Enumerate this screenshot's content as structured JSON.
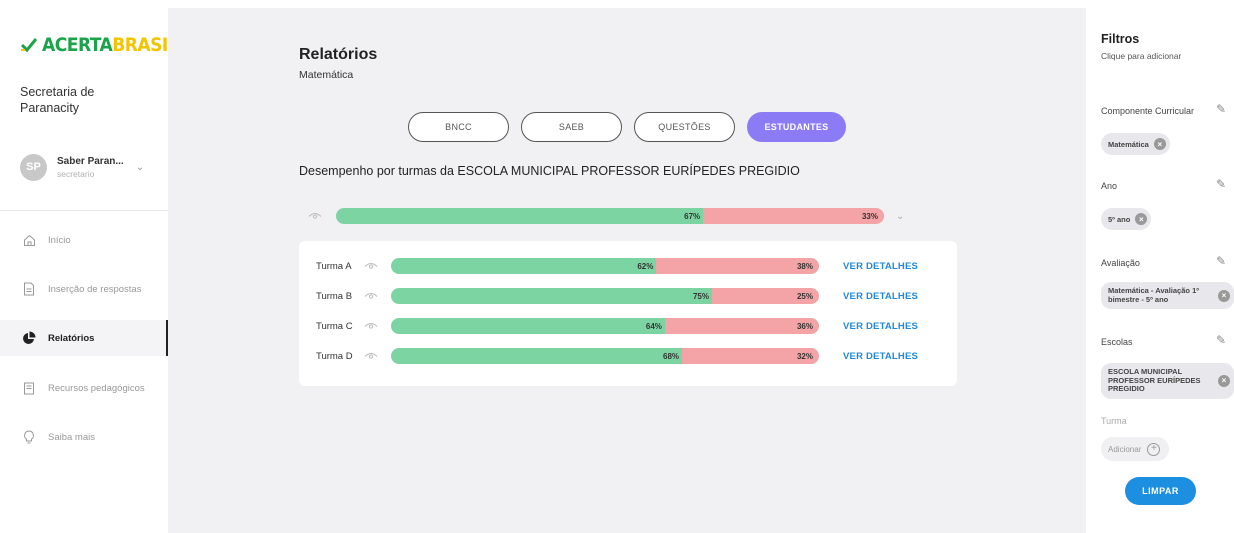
{
  "brand": {
    "part1": "ACERTA",
    "part2": "BRASIL"
  },
  "org": "Secretaria de Paranacity",
  "user": {
    "initials": "SP",
    "name": "Saber Paran...",
    "role": "secretario"
  },
  "nav": [
    {
      "label": "Início",
      "icon": "home-icon"
    },
    {
      "label": "Inserção de respostas",
      "icon": "document-icon"
    },
    {
      "label": "Relatórios",
      "icon": "pie-chart-icon"
    },
    {
      "label": "Recursos pedagógicos",
      "icon": "book-icon"
    },
    {
      "label": "Saiba mais",
      "icon": "lightbulb-icon"
    }
  ],
  "page": {
    "title": "Relatórios",
    "subtitle": "Matemática"
  },
  "tabs": [
    {
      "label": "BNCC",
      "active": false
    },
    {
      "label": "SAEB",
      "active": false
    },
    {
      "label": "QUESTÕES",
      "active": false
    },
    {
      "label": "ESTUDANTES",
      "active": true
    }
  ],
  "section_title": "Desempenho por turmas da ESCOLA MUNICIPAL PROFESSOR EURÍPEDES PREGIDIO",
  "overall": {
    "correct": 67,
    "incorrect": 33,
    "correct_label": "67%",
    "incorrect_label": "33%"
  },
  "classes": [
    {
      "name": "Turma A",
      "correct": 62,
      "incorrect": 38,
      "correct_label": "62%",
      "incorrect_label": "38%",
      "action": "VER DETALHES"
    },
    {
      "name": "Turma B",
      "correct": 75,
      "incorrect": 25,
      "correct_label": "75%",
      "incorrect_label": "25%",
      "action": "VER DETALHES"
    },
    {
      "name": "Turma C",
      "correct": 64,
      "incorrect": 36,
      "correct_label": "64%",
      "incorrect_label": "36%",
      "action": "VER DETALHES"
    },
    {
      "name": "Turma D",
      "correct": 68,
      "incorrect": 32,
      "correct_label": "68%",
      "incorrect_label": "32%",
      "action": "VER DETALHES"
    }
  ],
  "filters": {
    "title": "Filtros",
    "subtitle": "Clique para adicionar",
    "groups": [
      {
        "label": "Componente Curricular",
        "value": "Matemática"
      },
      {
        "label": "Ano",
        "value": "5º ano"
      },
      {
        "label": "Avaliação",
        "value": "Matemática - Avaliação 1º bimestre - 5º ano"
      },
      {
        "label": "Escolas",
        "value": "ESCOLA MUNICIPAL PROFESSOR EURÍPEDES PREGIDIO"
      }
    ],
    "turma_label": "Turma",
    "add_label": "Adicionar",
    "clear_label": "LIMPAR"
  },
  "colors": {
    "correct": "#7dd4a3",
    "incorrect": "#f4a4a6",
    "accent": "#8b7cf5",
    "link": "#2388d8",
    "primary_button": "#1c8fe0"
  }
}
